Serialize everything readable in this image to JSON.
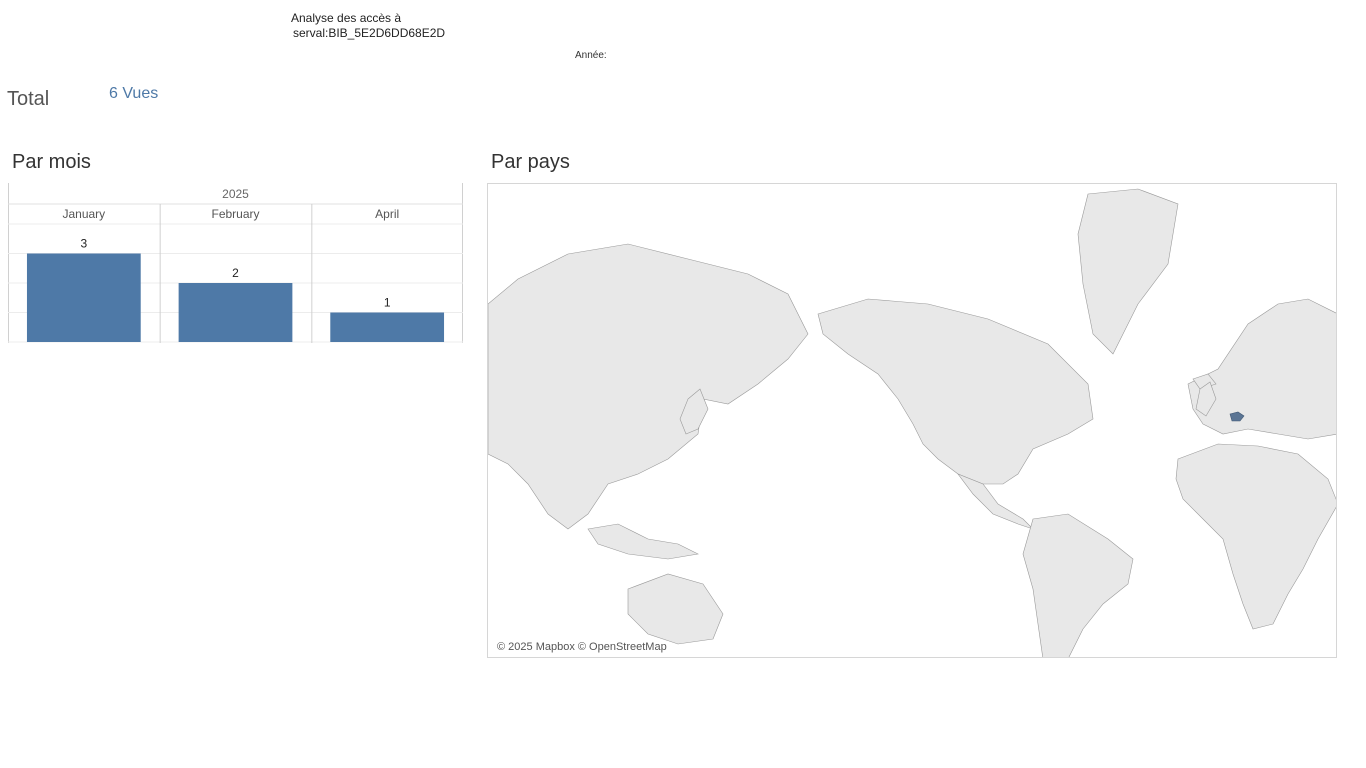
{
  "header": {
    "title_line1": "Analyse des accès à",
    "title_line2": "serval:BIB_5E2D6DD68E2D",
    "year_filter_label": "Année:"
  },
  "total": {
    "label": "Total",
    "value": "6 Vues"
  },
  "sections": {
    "by_month": "Par mois",
    "by_country": "Par pays"
  },
  "chart_data": {
    "type": "bar",
    "column_group": "2025",
    "categories": [
      "January",
      "February",
      "April"
    ],
    "values": [
      3,
      2,
      1
    ],
    "ylim": [
      0,
      4
    ],
    "grid": true,
    "bar_color": "#4e79a7"
  },
  "map": {
    "attribution": "© 2025 Mapbox © OpenStreetMap",
    "highlight_color": "#5b7594",
    "land_color": "#e8e8e8",
    "border_color": "#8a8a8a"
  }
}
